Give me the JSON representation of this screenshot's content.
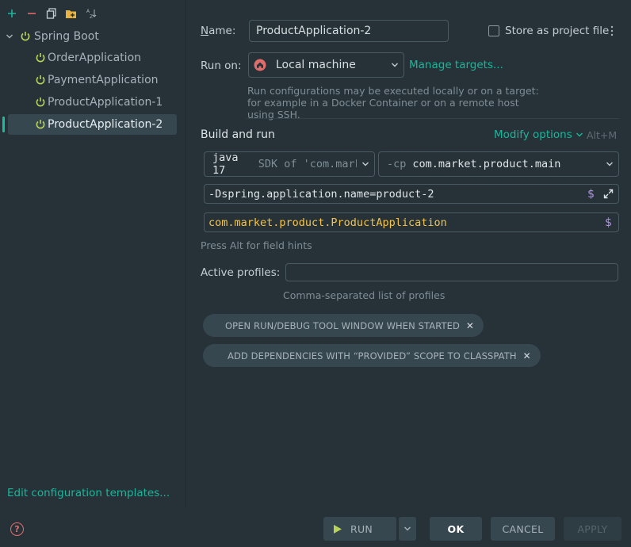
{
  "sidebar": {
    "group_label": "Spring Boot",
    "items": [
      {
        "label": "OrderApplication"
      },
      {
        "label": "PaymentApplication"
      },
      {
        "label": "ProductApplication-1"
      },
      {
        "label": "ProductApplication-2"
      }
    ],
    "edit_templates_link": "Edit configuration templates..."
  },
  "form": {
    "name_label_underlined": "N",
    "name_label_rest": "ame:",
    "name_value": "ProductApplication-2",
    "store_as_project_file": "Store as project file",
    "run_on_label": "Run on:",
    "run_on_value": "Local machine",
    "manage_targets": "Manage targets...",
    "run_on_hint": "Run configurations may be executed locally or on a target: for example in a Docker Container or on a remote host using SSH.",
    "build_and_run": "Build and run",
    "modify_options": "Modify options",
    "modify_shortcut": "Alt+M",
    "jdk_version": "java 17",
    "jdk_desc": "SDK of 'com.market",
    "cp_flag": "-cp",
    "cp_value": "com.market.product.main",
    "vm_options": "-Dspring.application.name=product-2",
    "main_class": "com.market.product.ProductApplication",
    "alt_hint": "Press Alt for field hints",
    "active_profiles_label": "Active profiles:",
    "active_profiles_value": "",
    "profiles_hint": "Comma-separated list of profiles",
    "chips": [
      {
        "label": "OPEN RUN/DEBUG TOOL WINDOW WHEN STARTED"
      },
      {
        "label": "ADD DEPENDENCIES WITH “PROVIDED” SCOPE TO CLASSPATH"
      }
    ]
  },
  "footer": {
    "run": "RUN",
    "ok": "OK",
    "cancel": "CANCEL",
    "apply": "APPLY"
  },
  "colors": {
    "accent": "#1ab69b",
    "background": "#263238",
    "selection": "#37474f",
    "power_icon": "#b8d35a",
    "main_class_text": "#f6c344",
    "variable_icon": "#b48ee8"
  }
}
